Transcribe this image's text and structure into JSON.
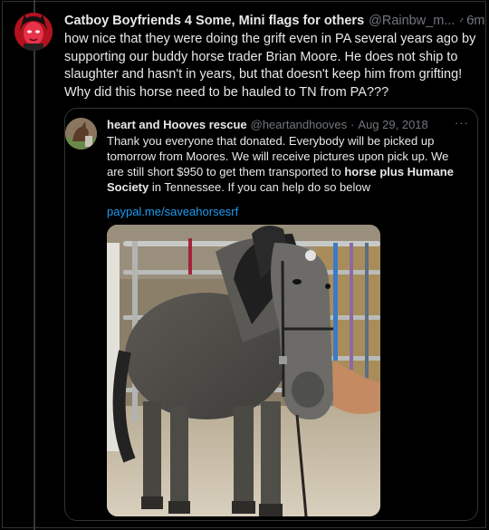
{
  "tweet": {
    "author_name": "Catboy Boyfriends 4 Some, Mini flags for others",
    "author_handle": "@Rainbw_m...",
    "separator": "·",
    "time": "6m",
    "more_label": "···",
    "text": "how nice that they were doing the grift even in PA several years ago by supporting our buddy horse trader Brian Moore. He does not ship to slaughter and hasn't in years, but that doesn't keep him from grifting! Why did this horse need to be hauled to TN from PA???"
  },
  "quoted": {
    "author_name": "heart and Hooves rescue",
    "author_handle": "@heartandhooves",
    "separator": "·",
    "date": "Aug 29, 2018",
    "more_label": "···",
    "text_part1": "Thank you everyone that donated. Everybody will be picked up tomorrow from Moores. We will receive pictures upon pick up. We are still short $950 to get them transported to ",
    "text_bold": "horse plus Humane Society",
    "text_part2": " in Tennessee. If you can help do so below",
    "link": "paypal.me/saveahorsesrf"
  },
  "icons": {
    "author_avatar": "avatar-red-face-icon",
    "quoted_avatar": "avatar-horse-icon",
    "photo": "gray-horse-photo"
  },
  "colors": {
    "background": "#000000",
    "text": "#e7e9ea",
    "secondary": "#71767b",
    "link": "#1d9bf0",
    "border": "#2f3336"
  }
}
